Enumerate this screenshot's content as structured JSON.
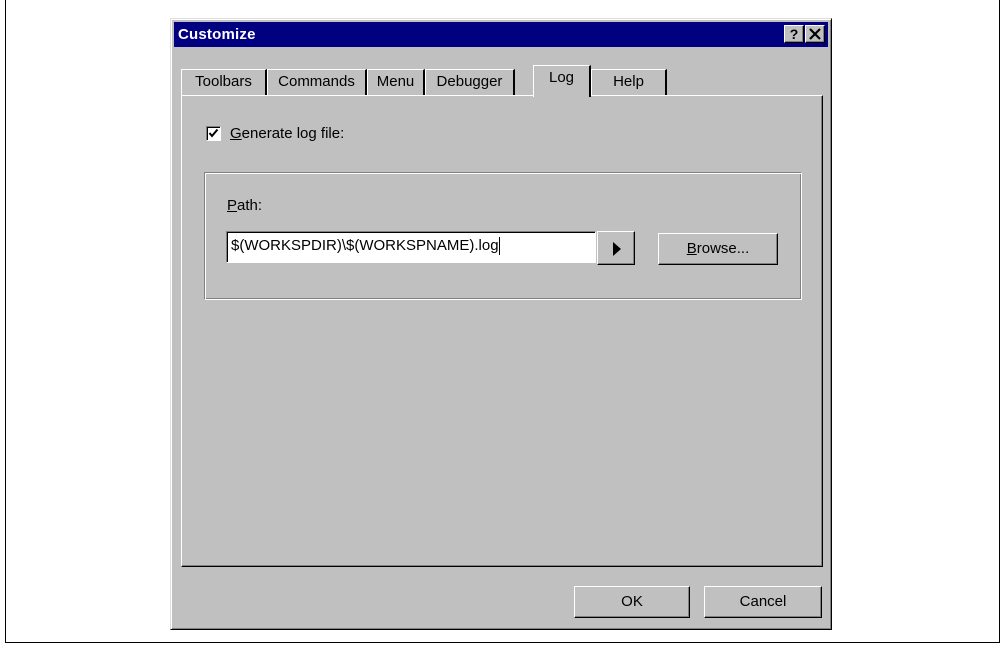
{
  "window": {
    "title": "Customize",
    "help_button": "?",
    "close_button": "✕"
  },
  "tabs": [
    {
      "label": "Toolbars",
      "active": false
    },
    {
      "label": "Commands",
      "active": false
    },
    {
      "label": "Menu",
      "active": false
    },
    {
      "label": "Debugger",
      "active": false
    },
    {
      "label": "Log",
      "active": true
    },
    {
      "label": "Help",
      "active": false
    }
  ],
  "log": {
    "generate_checked": true,
    "generate_label_mnemonic": "G",
    "generate_label_rest": "enerate log file:",
    "path_label_mnemonic": "P",
    "path_label_rest": "ath:",
    "path_value": "$(WORKSPDIR)\\$(WORKSPNAME).log",
    "browse_mnemonic": "B",
    "browse_rest": "rowse..."
  },
  "footer": {
    "ok_label": "OK",
    "cancel_label": "Cancel"
  }
}
